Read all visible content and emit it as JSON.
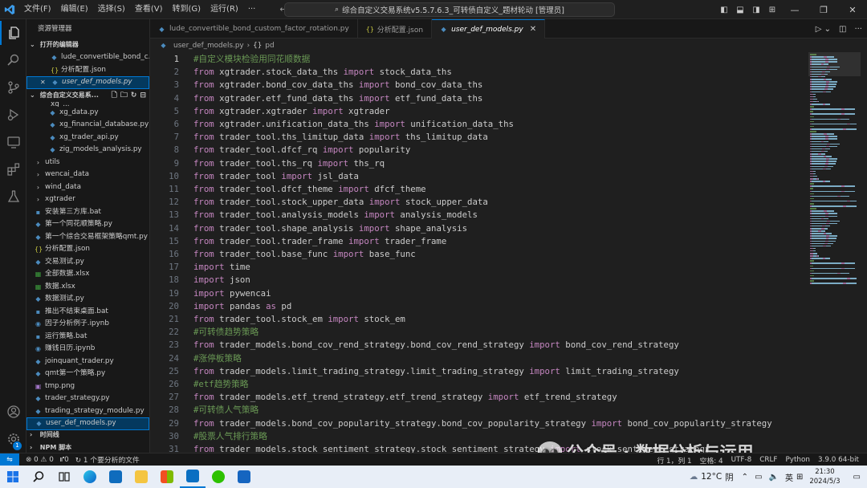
{
  "titlebar": {
    "menu": [
      "文件(F)",
      "编辑(E)",
      "选择(S)",
      "查看(V)",
      "转到(G)",
      "运行(R)"
    ],
    "command_center": "综合自定义交易系统v5.5.7.6.3_可转债自定义_题材轮动 [管理员]",
    "more": "···"
  },
  "sidebar": {
    "title": "资源管理器",
    "open_editors_label": "打开的编辑器",
    "open_editors": [
      {
        "name": "lude_convertible_bond_c...",
        "type": "py"
      },
      {
        "name": "分析配置.json",
        "type": "json"
      },
      {
        "name": "user_def_models.py",
        "type": "py"
      }
    ],
    "workspace_label": "综合自定义交易系...",
    "partial_top": "xg_...",
    "files": [
      {
        "name": "xg_data.py",
        "type": "py",
        "indent": 1
      },
      {
        "name": "xg_financial_database.py",
        "type": "py",
        "indent": 1
      },
      {
        "name": "xg_trader_api.py",
        "type": "py",
        "indent": 1
      },
      {
        "name": "zig_models_analysis.py",
        "type": "py",
        "indent": 1
      },
      {
        "name": "utils",
        "type": "folder",
        "indent": 0
      },
      {
        "name": "wencai_data",
        "type": "folder",
        "indent": 0
      },
      {
        "name": "wind_data",
        "type": "folder",
        "indent": 0
      },
      {
        "name": "xgtrader",
        "type": "folder",
        "indent": 0
      },
      {
        "name": "安装第三方库.bat",
        "type": "bat",
        "indent": 0
      },
      {
        "name": "第一个同花顺策略.py",
        "type": "py",
        "indent": 0
      },
      {
        "name": "第一个综合交易框架策略qmt.py",
        "type": "py",
        "indent": 0
      },
      {
        "name": "分析配置.json",
        "type": "json",
        "indent": 0
      },
      {
        "name": "交易测试.py",
        "type": "py",
        "indent": 0
      },
      {
        "name": "全部数据.xlsx",
        "type": "xlsx",
        "indent": 0
      },
      {
        "name": "数据.xlsx",
        "type": "xlsx",
        "indent": 0
      },
      {
        "name": "数据测试.py",
        "type": "py",
        "indent": 0
      },
      {
        "name": "推出不结束桌面.bat",
        "type": "bat",
        "indent": 0
      },
      {
        "name": "因子分析例子.ipynb",
        "type": "ipynb",
        "indent": 0
      },
      {
        "name": "运行策略.bat",
        "type": "bat",
        "indent": 0
      },
      {
        "name": "赚钱日历.ipynb",
        "type": "ipynb",
        "indent": 0
      },
      {
        "name": "joinquant_trader.py",
        "type": "py",
        "indent": 0
      },
      {
        "name": "qmt第一个策略.py",
        "type": "py",
        "indent": 0
      },
      {
        "name": "tmp.png",
        "type": "png",
        "indent": 0
      },
      {
        "name": "trader_strategy.py",
        "type": "py",
        "indent": 0
      },
      {
        "name": "trading_strategy_module.py",
        "type": "py",
        "indent": 0
      },
      {
        "name": "user_def_models.py",
        "type": "py",
        "indent": 0,
        "selected": true
      }
    ],
    "timeline_label": "时间线",
    "npm_label": "NPM 脚本"
  },
  "tabs": [
    {
      "label": "lude_convertible_bond_custom_factor_rotation.py",
      "icon": "py",
      "active": false
    },
    {
      "label": "分析配置.json",
      "icon": "json",
      "active": false
    },
    {
      "label": "user_def_models.py",
      "icon": "py",
      "active": true
    }
  ],
  "breadcrumb": {
    "file": "user_def_models.py",
    "symbol": "pd"
  },
  "editor": {
    "current_line": 1,
    "lines": [
      [
        [
          "cm",
          "#自定义模块检验用同花顺数据"
        ]
      ],
      [
        [
          "kw",
          "from"
        ],
        [
          "",
          " xgtrader.stock_data_ths "
        ],
        [
          "kw",
          "import"
        ],
        [
          "",
          " stock_data_ths"
        ]
      ],
      [
        [
          "kw",
          "from"
        ],
        [
          "",
          " xgtrader.bond_cov_data_ths "
        ],
        [
          "kw",
          "import"
        ],
        [
          "",
          " bond_cov_data_ths"
        ]
      ],
      [
        [
          "kw",
          "from"
        ],
        [
          "",
          " xgtrader.etf_fund_data_ths "
        ],
        [
          "kw",
          "import"
        ],
        [
          "",
          " etf_fund_data_ths"
        ]
      ],
      [
        [
          "kw",
          "from"
        ],
        [
          "",
          " xgtrader.xgtrader "
        ],
        [
          "kw",
          "import"
        ],
        [
          "",
          " xgtrader"
        ]
      ],
      [
        [
          "kw",
          "from"
        ],
        [
          "",
          " xgtrader.unification_data_ths "
        ],
        [
          "kw",
          "import"
        ],
        [
          "",
          " unification_data_ths"
        ]
      ],
      [
        [
          "kw",
          "from"
        ],
        [
          "",
          " trader_tool.ths_limitup_data "
        ],
        [
          "kw",
          "import"
        ],
        [
          "",
          " ths_limitup_data"
        ]
      ],
      [
        [
          "kw",
          "from"
        ],
        [
          "",
          " trader_tool.dfcf_rq "
        ],
        [
          "kw",
          "import"
        ],
        [
          "",
          " popularity"
        ]
      ],
      [
        [
          "kw",
          "from"
        ],
        [
          "",
          " trader_tool.ths_rq "
        ],
        [
          "kw",
          "import"
        ],
        [
          "",
          " ths_rq"
        ]
      ],
      [
        [
          "kw",
          "from"
        ],
        [
          "",
          " trader_tool "
        ],
        [
          "kw",
          "import"
        ],
        [
          "",
          " jsl_data"
        ]
      ],
      [
        [
          "kw",
          "from"
        ],
        [
          "",
          " trader_tool.dfcf_theme "
        ],
        [
          "kw",
          "import"
        ],
        [
          "",
          " dfcf_theme"
        ]
      ],
      [
        [
          "kw",
          "from"
        ],
        [
          "",
          " trader_tool.stock_upper_data "
        ],
        [
          "kw",
          "import"
        ],
        [
          "",
          " stock_upper_data"
        ]
      ],
      [
        [
          "kw",
          "from"
        ],
        [
          "",
          " trader_tool.analysis_models "
        ],
        [
          "kw",
          "import"
        ],
        [
          "",
          " analysis_models"
        ]
      ],
      [
        [
          "kw",
          "from"
        ],
        [
          "",
          " trader_tool.shape_analysis "
        ],
        [
          "kw",
          "import"
        ],
        [
          "",
          " shape_analysis"
        ]
      ],
      [
        [
          "kw",
          "from"
        ],
        [
          "",
          " trader_tool.trader_frame "
        ],
        [
          "kw",
          "import"
        ],
        [
          "",
          " trader_frame"
        ]
      ],
      [
        [
          "kw",
          "from"
        ],
        [
          "",
          " trader_tool.base_func "
        ],
        [
          "kw",
          "import"
        ],
        [
          "",
          " base_func"
        ]
      ],
      [
        [
          "kw",
          "import"
        ],
        [
          "",
          " time"
        ]
      ],
      [
        [
          "kw",
          "import"
        ],
        [
          "",
          " json"
        ]
      ],
      [
        [
          "kw",
          "import"
        ],
        [
          "",
          " pywencai"
        ]
      ],
      [
        [
          "kw",
          "import"
        ],
        [
          "",
          " pandas "
        ],
        [
          "kw",
          "as"
        ],
        [
          "",
          " pd"
        ]
      ],
      [
        [
          "kw",
          "from"
        ],
        [
          "",
          " trader_tool.stock_em "
        ],
        [
          "kw",
          "import"
        ],
        [
          "",
          " stock_em"
        ]
      ],
      [
        [
          "cm",
          "#可转债趋势策略"
        ]
      ],
      [
        [
          "kw",
          "from"
        ],
        [
          "",
          " trader_models.bond_cov_rend_strategy.bond_cov_rend_strategy "
        ],
        [
          "kw",
          "import"
        ],
        [
          "",
          " bond_cov_rend_strategy"
        ]
      ],
      [
        [
          "cm",
          "#涨停板策略"
        ]
      ],
      [
        [
          "kw",
          "from"
        ],
        [
          "",
          " trader_models.limit_trading_strategy.limit_trading_strategy "
        ],
        [
          "kw",
          "import"
        ],
        [
          "",
          " limit_trading_strategy"
        ]
      ],
      [
        [
          "cm",
          "#etf趋势策略"
        ]
      ],
      [
        [
          "kw",
          "from"
        ],
        [
          "",
          " trader_models.etf_trend_strategy.etf_trend_strategy "
        ],
        [
          "kw",
          "import"
        ],
        [
          "",
          " etf_trend_strategy"
        ]
      ],
      [
        [
          "cm",
          "#可转债人气策略"
        ]
      ],
      [
        [
          "kw",
          "from"
        ],
        [
          "",
          " trader_models.bond_cov_popularity_strategy.bond_cov_popularity_strategy "
        ],
        [
          "kw",
          "import"
        ],
        [
          "",
          " bond_cov_popularity_strategy"
        ]
      ],
      [
        [
          "cm",
          "#股票人气排行策略"
        ]
      ],
      [
        [
          "kw",
          "from"
        ],
        [
          "",
          " trader_models.stock_sentiment_strategy.stock_sentiment_strategy "
        ],
        [
          "kw",
          "import"
        ],
        [
          "",
          " stock_sentiment_strategy"
        ]
      ]
    ]
  },
  "status": {
    "problems": "⊗ 0 ⚠ 0",
    "ports": "⑈0",
    "analysis": "↻ 1 个要分析的文件",
    "position": "行 1，列 1",
    "spaces": "空格: 4",
    "encoding": "UTF-8",
    "eol": "CRLF",
    "language": "Python",
    "version": "3.9.0 64-bit"
  },
  "watermark": "公众号 · 数据分析与运用",
  "taskbar": {
    "weather_temp": "12°C",
    "weather_desc": "阴",
    "ime": "英",
    "time": "21:30",
    "date": "2024/5/3"
  },
  "colors": {
    "accent": "#0078d4",
    "keyword": "#c586c0",
    "comment": "#6a9955",
    "text": "#cccccc"
  }
}
